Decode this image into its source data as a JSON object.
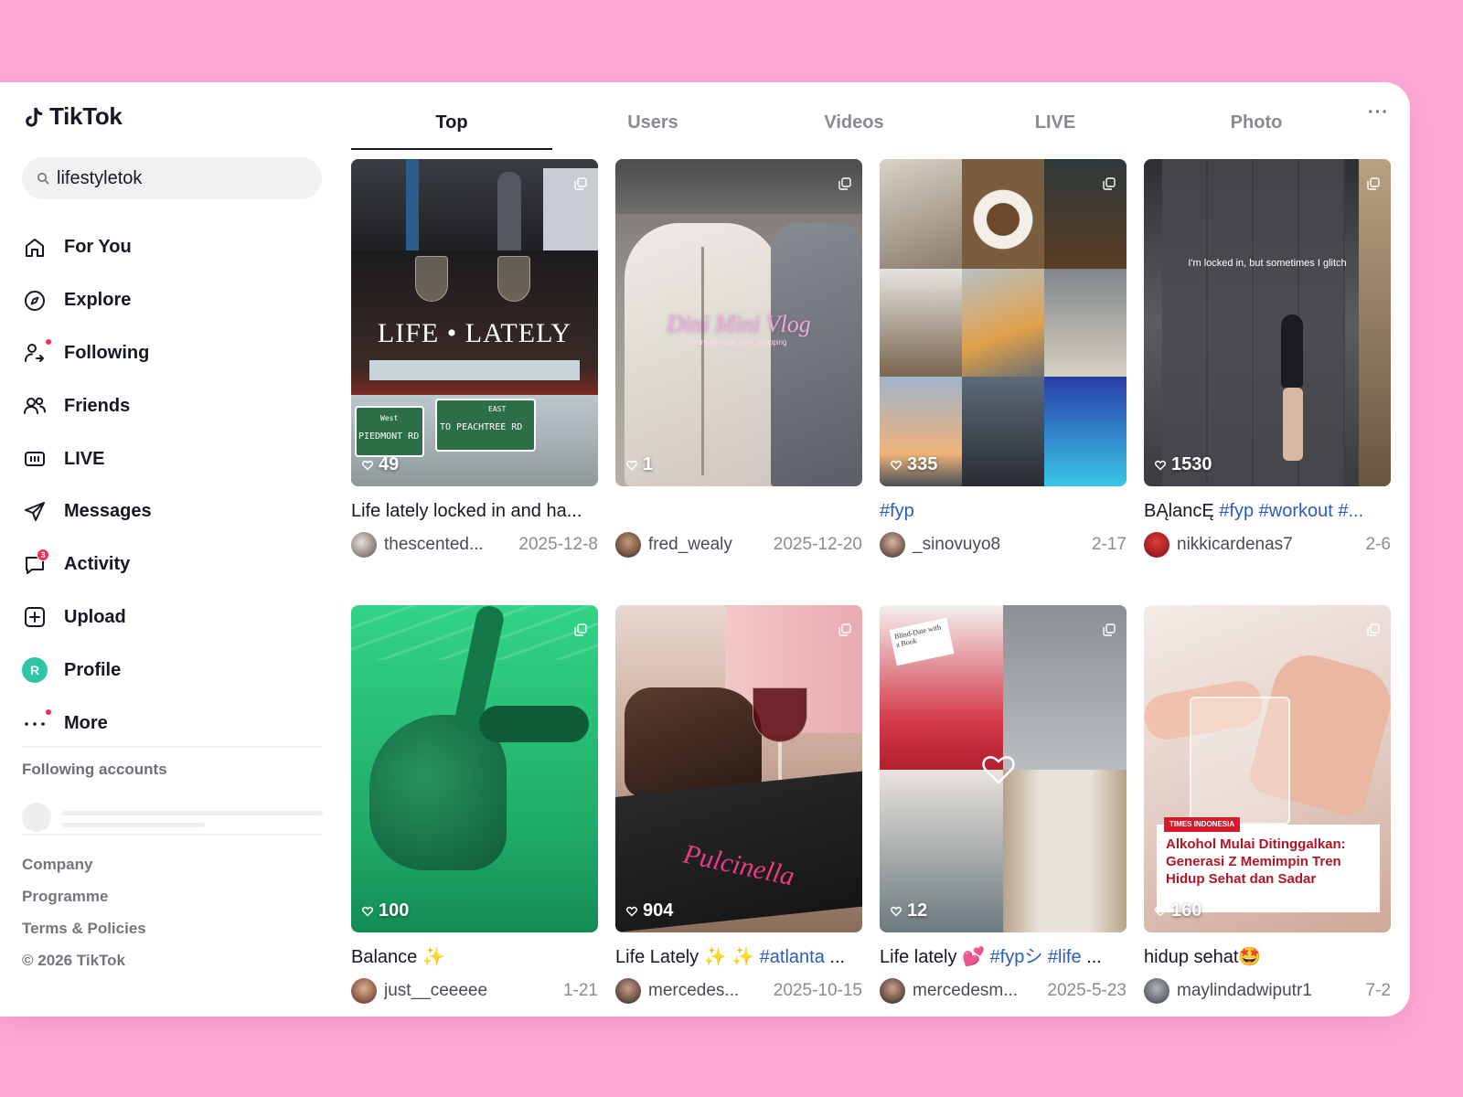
{
  "app": {
    "name": "TikTok"
  },
  "search": {
    "value": "lifestyletok"
  },
  "nav": [
    {
      "label": "For You",
      "icon": "home-icon"
    },
    {
      "label": "Explore",
      "icon": "compass-icon"
    },
    {
      "label": "Following",
      "icon": "following-icon",
      "dot": true
    },
    {
      "label": "Friends",
      "icon": "friends-icon"
    },
    {
      "label": "LIVE",
      "icon": "live-icon"
    },
    {
      "label": "Messages",
      "icon": "send-icon"
    },
    {
      "label": "Activity",
      "icon": "activity-icon",
      "badge": "3"
    },
    {
      "label": "Upload",
      "icon": "upload-icon"
    },
    {
      "label": "Profile",
      "icon": "avatar",
      "avatar_letter": "R"
    },
    {
      "label": "More",
      "icon": "more-icon",
      "dot": true
    }
  ],
  "following": {
    "title": "Following accounts"
  },
  "footer": {
    "company": "Company",
    "programme": "Programme",
    "terms": "Terms & Policies",
    "copyright": "© 2026 TikTok"
  },
  "tabs": [
    "Top",
    "Users",
    "Videos",
    "LIVE",
    "Photo"
  ],
  "tabs_more": "···",
  "overlays": {
    "life_lately": "LIFE • LATELY",
    "sign_left_top": "West",
    "sign_left": "PIEDMONT RD",
    "sign_right_top": "EAST",
    "sign_right": "TO PEACHTREE RD",
    "vlog_title": "Dini Mini Vlog",
    "vlog_sub": "morning ritual, gym, shopping",
    "locked_in": "I'm locked in, but sometimes I glitch",
    "news_brand": "TIMES INDONESIA",
    "news_headline": "Alkohol Mulai Ditinggalkan: Generasi Z Memimpin Tren Hidup Sehat dan Sadar",
    "book_note": "Blind-Date with a Book",
    "menu_brand": "Pulcinella"
  },
  "videos": [
    {
      "likes": "49",
      "desc": "Life lately locked in and ha...",
      "tags": [],
      "user": "thescented...",
      "date": "2025-12-8"
    },
    {
      "likes": "1",
      "desc": "",
      "tags": [],
      "user": "fred_wealy",
      "date": "2025-12-20"
    },
    {
      "likes": "335",
      "desc": "",
      "tags": [
        "#fyp"
      ],
      "user": "_sinovuyo8",
      "date": "2-17"
    },
    {
      "likes": "1530",
      "desc": "BĄlancĘ",
      "tags": [
        "#fyp",
        "#workout",
        "#..."
      ],
      "user": "nikkicardenas7",
      "date": "2-6"
    },
    {
      "likes": "100",
      "desc": "Balance ✨",
      "tags": [],
      "user": "just__ceeeee",
      "date": "1-21"
    },
    {
      "likes": "904",
      "desc": "Life Lately ✨ ✨",
      "tags": [
        "#atlanta",
        "..."
      ],
      "user": "mercedes...",
      "date": "2025-10-15"
    },
    {
      "likes": "12",
      "desc": "Life lately 💕",
      "tags": [
        "#fypシ",
        "#life",
        "..."
      ],
      "user": "mercedesm...",
      "date": "2025-5-23"
    },
    {
      "likes": "160",
      "desc": "hidup sehat🤩",
      "tags": [],
      "user": "maylindadwiputr1",
      "date": "7-2"
    }
  ],
  "colors": {
    "background": "#ffa8d6",
    "accent": "#fe2c55",
    "hashtag": "#2b5db9",
    "profile_avatar": "#2ec4a6"
  }
}
